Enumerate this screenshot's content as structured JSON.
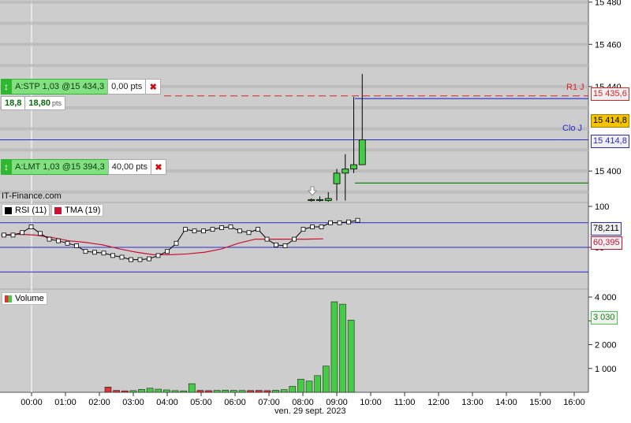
{
  "colors": {
    "panel_bg": "#cdcdcd",
    "grid": "#b7b7b7",
    "candle_up": "#44cc44",
    "resistance": "#dd2222",
    "close_level": "#2a2ad0",
    "limit_level": "#118811",
    "rsi": "#000000",
    "tma": "#cc1133",
    "volume_up": "#44cc44",
    "volume_down": "#dd3333",
    "current_price_bg": "#f5c400"
  },
  "branding": "IT-Finance.com",
  "orders": {
    "stop": {
      "label": "A:STP  1,03 @15 434,3",
      "pts": "0,00 pts",
      "icon": "updown-arrow-icon",
      "close": "✖"
    },
    "limit": {
      "label": "A:LMT  1,03 @15 394,3",
      "pts": "40,00 pts",
      "icon": "updown-arrow-icon",
      "close": "✖"
    }
  },
  "stop_ticks": {
    "value": "18,8",
    "points": "18,80",
    "unit": "pts"
  },
  "levels": {
    "r1": {
      "name": "R1 J",
      "value": "15 435,6"
    },
    "clo": {
      "name": "Clo J",
      "value": "15 414,8"
    },
    "current": "15 414,8"
  },
  "legends": {
    "rsi": "RSI (11)",
    "tma": "TMA (19)",
    "volume": "Volume"
  },
  "indicator_tags": {
    "rsi": "78,211",
    "tma": "60,395",
    "volume": "3 030"
  },
  "date_label": "ven. 29 sept. 2023",
  "chart_data": [
    {
      "type": "candlestick",
      "title": "",
      "y_ticks": [
        "15 480",
        "15 460",
        "15 440",
        "15 400"
      ],
      "y_tick_values": [
        15480,
        15460,
        15440,
        15400
      ],
      "ylim": [
        15385.5,
        15481
      ],
      "x_ticks": [
        "00:00",
        "01:00",
        "02:00",
        "03:00",
        "04:00",
        "05:00",
        "06:00",
        "07:00",
        "08:00",
        "09:00",
        "10:00",
        "11:00",
        "12:00",
        "13:00",
        "14:00",
        "15:00",
        "16:00"
      ],
      "candles": [
        {
          "time": "08:15",
          "open": 15386,
          "high": 15387,
          "low": 15385.5,
          "close": 15386.5
        },
        {
          "time": "08:30",
          "open": 15386,
          "high": 15388,
          "low": 15385.5,
          "close": 15386.5
        },
        {
          "time": "08:45",
          "open": 15386,
          "high": 15390,
          "low": 15385.5,
          "close": 15387
        },
        {
          "time": "09:00",
          "open": 15394,
          "high": 15401,
          "low": 15386,
          "close": 15399
        },
        {
          "time": "09:15",
          "open": 15399,
          "high": 15408,
          "low": 15386,
          "close": 15401
        },
        {
          "time": "09:30",
          "open": 15401,
          "high": 15435,
          "low": 15399,
          "close": 15403
        },
        {
          "time": "09:45",
          "open": 15403,
          "high": 15446,
          "low": 15403,
          "close": 15414.8
        }
      ],
      "horizontal_levels": [
        {
          "name": "R1 J",
          "value": 15435.6,
          "style": "dashed"
        },
        {
          "name": "stop order",
          "value": 15434.3,
          "style": "solid"
        },
        {
          "name": "Clo J",
          "value": 15414.8,
          "style": "solid"
        },
        {
          "name": "limit order",
          "value": 15394.3,
          "style": "solid"
        }
      ],
      "grid": true
    },
    {
      "type": "line",
      "title": "",
      "y_ticks": [
        "100",
        "50"
      ],
      "y_tick_values": [
        100,
        50
      ],
      "ylim": [
        0,
        100
      ],
      "reference_lines": [
        80,
        50,
        20
      ],
      "series": [
        {
          "name": "RSI (11)",
          "x_hours": [
            0,
            0.25,
            0.5,
            0.75,
            1,
            1.25,
            1.5,
            1.75,
            2,
            2.25,
            2.5,
            2.75,
            3,
            3.25,
            3.5,
            3.75,
            4,
            4.25,
            4.5,
            4.75,
            5,
            5.25,
            5.5,
            5.75,
            6,
            6.25,
            6.5,
            6.75,
            7,
            7.25,
            7.5,
            7.75,
            8,
            8.25,
            8.5,
            8.75,
            9,
            9.25,
            9.5,
            9.75
          ],
          "values": [
            65,
            65,
            68,
            75,
            67,
            60,
            58,
            55,
            52,
            45,
            44,
            43,
            40,
            38,
            35,
            35,
            36,
            40,
            45,
            55,
            72,
            70,
            70,
            72,
            74,
            75,
            70,
            68,
            72,
            60,
            53,
            52,
            60,
            72,
            75,
            75,
            80,
            80,
            81,
            83
          ]
        },
        {
          "name": "TMA (19)",
          "x_hours": [
            0,
            0.5,
            1,
            1.5,
            2,
            2.5,
            3,
            3.5,
            4,
            4.5,
            5,
            5.5,
            6,
            6.5,
            7,
            7.5,
            8,
            8.5,
            9,
            9.5
          ],
          "values": [
            65,
            66,
            65,
            62,
            58,
            56,
            53,
            48,
            44,
            41,
            41,
            42,
            44,
            48,
            55,
            60,
            60,
            60,
            60,
            60.4
          ]
        }
      ],
      "legend": [
        "RSI (11)",
        "TMA (19)"
      ]
    },
    {
      "type": "bar",
      "title": "",
      "y_ticks": [
        "4 000",
        "3 000",
        "2 000",
        "1 000"
      ],
      "y_tick_values": [
        4000,
        3000,
        2000,
        1000
      ],
      "ylim": [
        0,
        4300
      ],
      "series": [
        {
          "name": "Volume",
          "x_hours": [
            2.25,
            2.5,
            2.75,
            3,
            3.25,
            3.5,
            3.75,
            4,
            4.25,
            4.5,
            4.75,
            5,
            5.25,
            5.5,
            5.75,
            6,
            6.25,
            6.5,
            6.75,
            7,
            7.25,
            7.5,
            7.75,
            8,
            8.25,
            8.5,
            8.75,
            9,
            9.25,
            9.5
          ],
          "values": [
            220,
            80,
            60,
            70,
            120,
            170,
            130,
            100,
            70,
            60,
            360,
            80,
            70,
            80,
            90,
            80,
            75,
            75,
            80,
            70,
            90,
            110,
            250,
            550,
            470,
            700,
            1100,
            3800,
            3700,
            3030
          ],
          "direction": [
            "down",
            "down",
            "down",
            "up",
            "up",
            "up",
            "up",
            "up",
            "up",
            "up",
            "up",
            "down",
            "down",
            "up",
            "up",
            "up",
            "up",
            "down",
            "down",
            "down",
            "up",
            "up",
            "up",
            "up",
            "up",
            "up",
            "up",
            "up",
            "up",
            "up"
          ]
        }
      ],
      "legend": [
        "Volume"
      ]
    }
  ]
}
